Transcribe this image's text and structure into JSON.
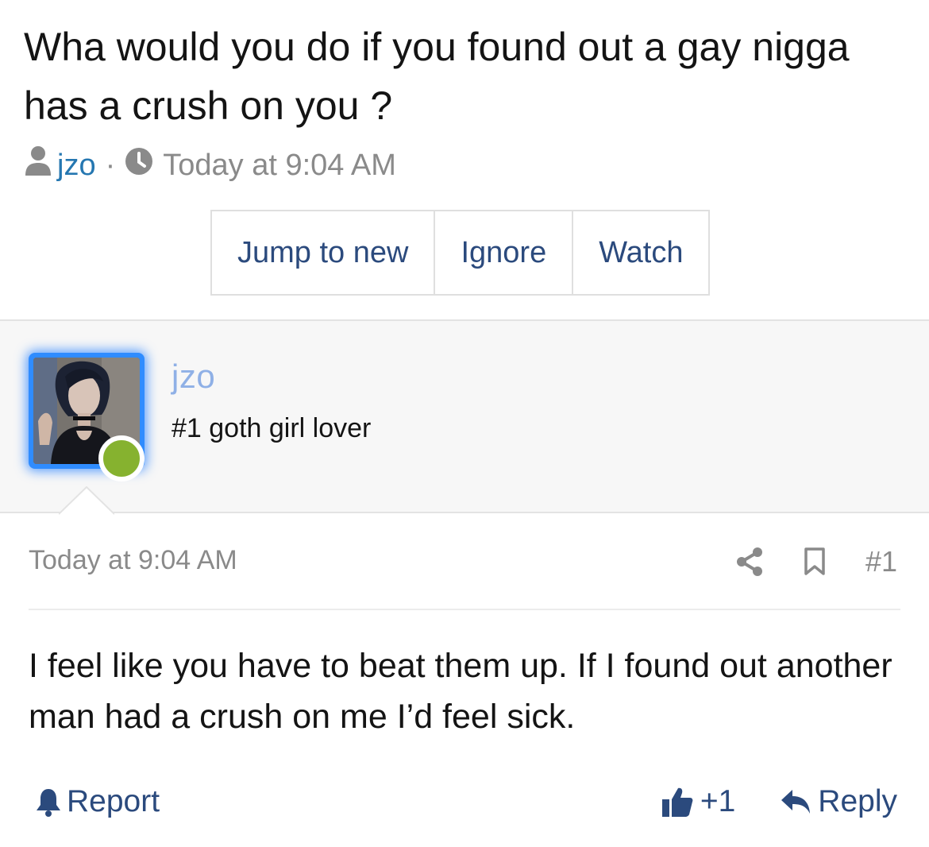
{
  "thread": {
    "title": "Wha would you do if you found out a gay nigga has a crush on you ?",
    "author": "jzo",
    "separator": "·",
    "timestamp": "Today at 9:04 AM"
  },
  "actions": {
    "jump_to_new": "Jump to new",
    "ignore": "Ignore",
    "watch": "Watch"
  },
  "user": {
    "name": "jzo",
    "title": "#1 goth girl lover",
    "status": "online"
  },
  "post": {
    "date": "Today at 9:04 AM",
    "number": "#1",
    "body": "I feel like you have to beat them up. If I found out another man had a crush on me I’d feel sick."
  },
  "footer": {
    "report": "Report",
    "reaction_count": "+1",
    "reply": "Reply"
  },
  "colors": {
    "link": "#2577b1",
    "button_text": "#2b4a7d",
    "muted": "#8a8a8a",
    "username": "#8fb0e6",
    "avatar_glow": "#2f8cff",
    "online": "#86b22f"
  },
  "icons": {
    "author": "user-icon",
    "time": "clock-icon",
    "share": "share-icon",
    "bookmark": "bookmark-icon",
    "report": "bell-icon",
    "like": "thumbs-up-icon",
    "reply": "reply-icon"
  }
}
